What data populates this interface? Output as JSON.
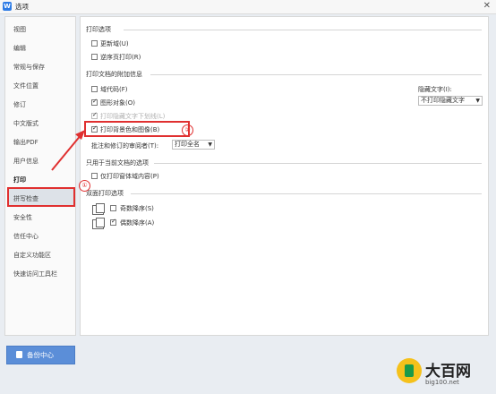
{
  "window": {
    "title": "选项",
    "app_icon": "W"
  },
  "sidebar": {
    "items": [
      "视图",
      "编辑",
      "常规与保存",
      "文件位置",
      "修订",
      "中文版式",
      "输出PDF",
      "用户信息",
      "打印",
      "拼写检查",
      "安全性",
      "信任中心",
      "自定义功能区",
      "快速访问工具栏"
    ],
    "active": "打印"
  },
  "print_options": {
    "header": "打印选项",
    "update_fields": "更新域(U)",
    "reverse_order": "逆序页打印(R)"
  },
  "attached_info": {
    "header": "打印文档的附加信息",
    "field_codes": "域代码(F)",
    "drawing_objects": "图形对象(O)",
    "hidden_text_underline": "打印隐藏文字下划线(L)",
    "background": "打印背景色和图像(B)",
    "reviewer_label": "批注和修订的审阅者(T):",
    "reviewer_value": "打印全名",
    "hidden_text_label": "隐藏文字(I):",
    "hidden_text_value": "不打印隐藏文字"
  },
  "current_doc": {
    "header": "只用于当前文档的选项",
    "form_fields_only": "仅打印窗体域内容(P)"
  },
  "duplex": {
    "header": "双面打印选项",
    "odd_reverse": "奇数降序(S)",
    "even_reverse": "偶数降序(A)"
  },
  "annotations": {
    "step1": "①",
    "step2": "②"
  },
  "footer": {
    "backup_label": "备份中心"
  },
  "watermark": {
    "brand": "大百网",
    "url": "big100.net"
  },
  "checkbox_state": {
    "update_fields": false,
    "reverse_order": false,
    "field_codes": false,
    "drawing_objects": true,
    "hidden_text_underline": true,
    "background": true,
    "form_fields_only": false,
    "odd_reverse": false,
    "even_reverse": true
  },
  "colors": {
    "annotation_red": "#e03030",
    "button_blue": "#5b8ed8"
  }
}
